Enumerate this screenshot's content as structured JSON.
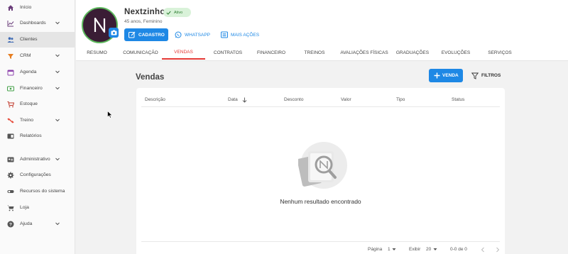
{
  "colors": {
    "accent": "#1e88e5",
    "active_tab": "#e53935",
    "badge_bg": "#d9f2d9",
    "badge_text": "#2e7d32"
  },
  "sidebar": {
    "items": [
      {
        "label": "Início",
        "icon": "home-icon",
        "expandable": false,
        "active": false
      },
      {
        "label": "Dashboards",
        "icon": "chart-line-icon",
        "expandable": true,
        "active": false
      },
      {
        "label": "Clientes",
        "icon": "people-icon",
        "expandable": false,
        "active": true
      },
      {
        "label": "CRM",
        "icon": "crm-icon",
        "expandable": true,
        "active": false
      },
      {
        "label": "Agenda",
        "icon": "calendar-icon",
        "expandable": true,
        "active": false
      },
      {
        "label": "Financeiro",
        "icon": "money-icon",
        "expandable": true,
        "active": false
      },
      {
        "label": "Estoque",
        "icon": "cart-icon",
        "expandable": false,
        "active": false
      },
      {
        "label": "Treino",
        "icon": "dumbbell-icon",
        "expandable": true,
        "active": false
      },
      {
        "label": "Relatórios",
        "icon": "report-icon",
        "expandable": false,
        "active": false
      },
      {
        "label": "Administrativo",
        "icon": "id-card-icon",
        "expandable": true,
        "active": false
      },
      {
        "label": "Configurações",
        "icon": "gear-icon",
        "expandable": false,
        "active": false
      },
      {
        "label": "Recursos do sistema",
        "icon": "toggle-icon",
        "expandable": false,
        "active": false
      },
      {
        "label": "Loja",
        "icon": "shop-cart-icon",
        "expandable": false,
        "active": false
      },
      {
        "label": "Ajuda",
        "icon": "help-icon",
        "expandable": true,
        "active": false
      }
    ]
  },
  "client": {
    "name": "Nextzinho",
    "status": "Ativo",
    "subtitle": "45 anos, Feminino",
    "avatar_letter": "N",
    "actions": {
      "cadastro": "CADASTRO",
      "whatsapp": "WHATSAPP",
      "mais_acoes": "MAIS AÇÕES"
    }
  },
  "tabs": [
    {
      "label": "RESUMO",
      "active": false
    },
    {
      "label": "COMUNICAÇÃO",
      "active": false
    },
    {
      "label": "VENDAS",
      "active": true
    },
    {
      "label": "CONTRATOS",
      "active": false
    },
    {
      "label": "FINANCEIRO",
      "active": false
    },
    {
      "label": "TREINOS",
      "active": false
    },
    {
      "label": "AVALIAÇÕES FÍSICAS",
      "active": false
    },
    {
      "label": "GRADUAÇÕES",
      "active": false
    },
    {
      "label": "EVOLUÇÕES",
      "active": false
    },
    {
      "label": "SERVIÇOS",
      "active": false
    }
  ],
  "main": {
    "title": "Vendas",
    "new_button": "VENDA",
    "filter_button": "FILTROS",
    "columns": [
      "Descrição",
      "Data",
      "Desconto",
      "Valor",
      "Tipo",
      "Status"
    ],
    "empty_message": "Nenhum resultado encontrado"
  },
  "pagination": {
    "page_label": "Página",
    "page_value": "1",
    "per_page_label": "Exibir",
    "per_page_value": "20",
    "range": "0-0 de 0"
  }
}
